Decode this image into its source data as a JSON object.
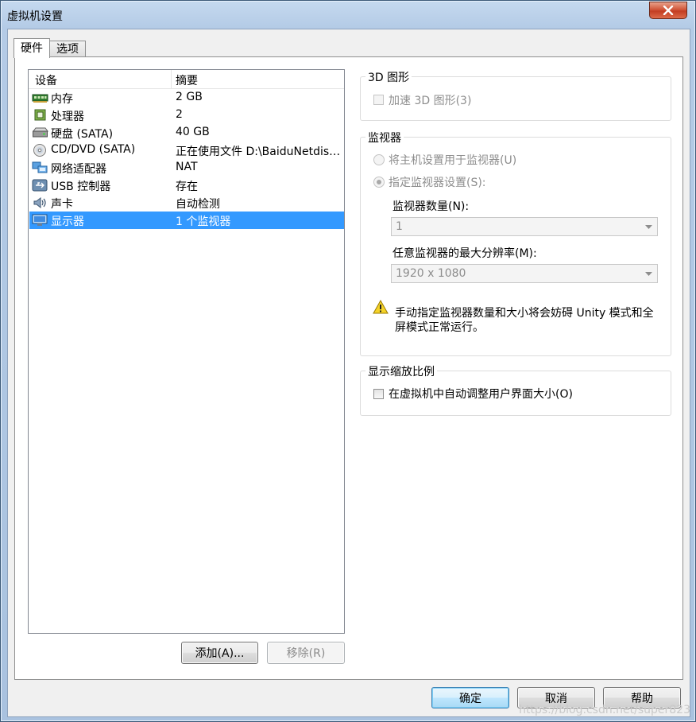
{
  "window": {
    "title": "虚拟机设置"
  },
  "tabs": [
    {
      "label": "硬件",
      "active": true
    },
    {
      "label": "选项",
      "active": false
    }
  ],
  "device_list": {
    "columns": [
      "设备",
      "摘要"
    ],
    "rows": [
      {
        "icon": "memory-icon",
        "name": "内存",
        "summary": "2 GB",
        "selected": false
      },
      {
        "icon": "processor-icon",
        "name": "处理器",
        "summary": "2",
        "selected": false
      },
      {
        "icon": "hard-disk-icon",
        "name": "硬盘 (SATA)",
        "summary": "40 GB",
        "selected": false
      },
      {
        "icon": "cd-dvd-icon",
        "name": "CD/DVD (SATA)",
        "summary": "正在使用文件 D:\\BaiduNetdis…",
        "selected": false
      },
      {
        "icon": "network-adapter-icon",
        "name": "网络适配器",
        "summary": "NAT",
        "selected": false
      },
      {
        "icon": "usb-icon",
        "name": "USB 控制器",
        "summary": "存在",
        "selected": false
      },
      {
        "icon": "sound-card-icon",
        "name": "声卡",
        "summary": "自动检测",
        "selected": false
      },
      {
        "icon": "display-icon",
        "name": "显示器",
        "summary": "1 个监视器",
        "selected": true
      }
    ]
  },
  "list_buttons": {
    "add": "添加(A)...",
    "remove": "移除(R)"
  },
  "graphics_group": {
    "title": "3D 图形",
    "accelerate_label": "加速 3D 图形(3)",
    "accelerate_checked": false
  },
  "monitor_group": {
    "title": "监视器",
    "use_host_label": "将主机设置用于监视器(U)",
    "specify_label": "指定监视器设置(S):",
    "specify_selected": true,
    "count_label": "监视器数量(N):",
    "count_value": "1",
    "resolution_label": "任意监视器的最大分辨率(M):",
    "resolution_value": "1920 x 1080",
    "warning_text": "手动指定监视器数量和大小将会妨碍 Unity 模式和全屏模式正常运行。"
  },
  "scaling_group": {
    "title": "显示缩放比例",
    "autofit_label": "在虚拟机中自动调整用户界面大小(O)",
    "autofit_checked": false
  },
  "footer_buttons": {
    "ok": "确定",
    "cancel": "取消",
    "help": "帮助"
  },
  "watermark": "https://blog.csdn.net/super823"
}
